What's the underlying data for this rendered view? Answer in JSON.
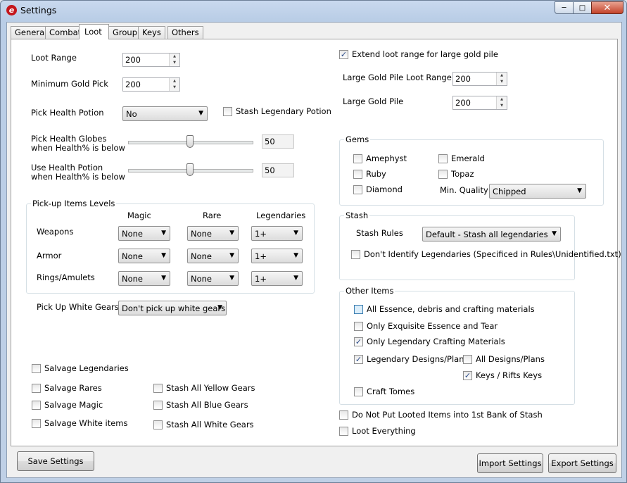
{
  "window": {
    "title": "Settings"
  },
  "tabs": [
    "General",
    "Combat",
    "Loot",
    "Group",
    "Keys",
    "Others"
  ],
  "loot": {
    "loot_range": {
      "label": "Loot Range",
      "value": "200"
    },
    "min_gold_pick": {
      "label": "Minimum Gold Pick",
      "value": "200"
    },
    "pick_health_potion": {
      "label": "Pick Health Potion",
      "value": "No"
    },
    "stash_legendary_potion": {
      "label": "Stash Legendary Potion",
      "checked": false
    },
    "health_globes": {
      "label1": "Pick Health Globes",
      "label2": "when Health% is below",
      "value": "50",
      "level": 50
    },
    "use_health_potion": {
      "label1": "Use Health Potion",
      "label2": "when Health% is below",
      "value": "50",
      "level": 50
    },
    "pickup_levels": {
      "title": "Pick-up Items Levels",
      "columns": [
        "Magic",
        "Rare",
        "Legendaries"
      ],
      "rows": [
        {
          "label": "Weapons",
          "values": [
            "None",
            "None",
            "1+"
          ]
        },
        {
          "label": "Armor",
          "values": [
            "None",
            "None",
            "1+"
          ]
        },
        {
          "label": "Rings/Amulets",
          "values": [
            "None",
            "None",
            "1+"
          ]
        }
      ]
    },
    "white_gears": {
      "label": "Pick Up White Gears",
      "value": "Don't pick up white gears"
    },
    "salvage": [
      {
        "label": "Salvage Legendaries",
        "checked": false
      },
      {
        "label": "Salvage Rares",
        "checked": false
      },
      {
        "label": "Salvage Magic",
        "checked": false
      },
      {
        "label": "Salvage White items",
        "checked": false
      }
    ],
    "stash_gears": [
      {
        "label": "Stash All Yellow Gears",
        "checked": false
      },
      {
        "label": "Stash All Blue Gears",
        "checked": false
      },
      {
        "label": "Stash All White Gears",
        "checked": false
      }
    ],
    "extend_loot": {
      "label": "Extend loot range for large gold pile",
      "checked": true
    },
    "large_gold_range": {
      "label": "Large Gold Pile Loot Range",
      "value": "200"
    },
    "large_gold_pile": {
      "label": "Large Gold Pile",
      "value": "200"
    },
    "gems": {
      "title": "Gems",
      "items": [
        {
          "label": "Amephyst",
          "checked": false
        },
        {
          "label": "Emerald",
          "checked": false
        },
        {
          "label": "Ruby",
          "checked": false
        },
        {
          "label": "Topaz",
          "checked": false
        },
        {
          "label": "Diamond",
          "checked": false
        }
      ],
      "min_quality_label": "Min. Quality",
      "min_quality": "Chipped"
    },
    "stash": {
      "title": "Stash",
      "rules_label": "Stash Rules",
      "rules_value": "Default - Stash all legendaries",
      "dont_identify": {
        "label": "Don't Identify Legendaries (Specificed in Rules\\Unidentified.txt)",
        "checked": false
      }
    },
    "other_items": {
      "title": "Other Items",
      "items": [
        {
          "label": "All Essence, debris and crafting materials",
          "checked": false
        },
        {
          "label": "Only Exquisite Essence and Tear",
          "checked": false
        },
        {
          "label": "Only Legendary Crafting Materials",
          "checked": true
        },
        {
          "label": "Legendary Designs/Plans",
          "checked": true
        },
        {
          "label": "All Designs/Plans",
          "checked": false
        },
        {
          "label": "Keys / Rifts Keys",
          "checked": true
        },
        {
          "label": "Craft Tomes",
          "checked": false
        }
      ]
    },
    "do_not_put_first_bank": {
      "label": "Do Not Put Looted Items into 1st Bank of Stash",
      "checked": false
    },
    "loot_everything": {
      "label": "Loot Everything",
      "checked": false
    }
  },
  "buttons": {
    "save": "Save Settings",
    "import": "Import Settings",
    "export": "Export Settings"
  },
  "colors": {
    "check_mark": "#2a4a88",
    "close_button": "#c4432a",
    "highlight_checkbox": "#dceefa"
  }
}
